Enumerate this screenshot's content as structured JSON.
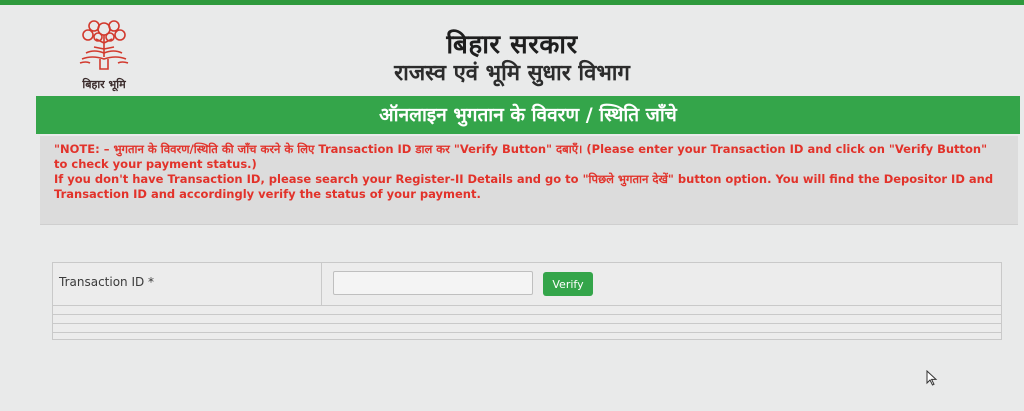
{
  "header": {
    "logo_text": "बिहार भूमि",
    "title_line1": "बिहार सरकार",
    "title_line2": "राजस्व एवं भूमि सुधार विभाग"
  },
  "banner": {
    "title": "ऑनलाइन भुगतान के विवरण / स्थिति जाँचे"
  },
  "note": {
    "line1": "\"NOTE: – भुगतान के विवरण/स्थिति की जाँच करने के लिए Transaction ID डाल कर \"Verify Button\" दबाएँ। (Please enter your Transaction ID and click on \"Verify Button\" to check your payment status.)",
    "line2": "If you don't have Transaction ID, please search your Register-II Details and go to \"पिछले भुगतान देखें\" button option. You will find the Depositor ID and Transaction ID and accordingly verify the status of your payment."
  },
  "form": {
    "transaction_label": "Transaction ID *",
    "transaction_value": "",
    "transaction_placeholder": "",
    "verify_label": "Verify"
  },
  "colors": {
    "accent_green": "#34a54a",
    "note_red": "#e2322a"
  },
  "icons": {
    "logo": "tree-emblem-icon",
    "cursor": "mouse-pointer-icon"
  }
}
